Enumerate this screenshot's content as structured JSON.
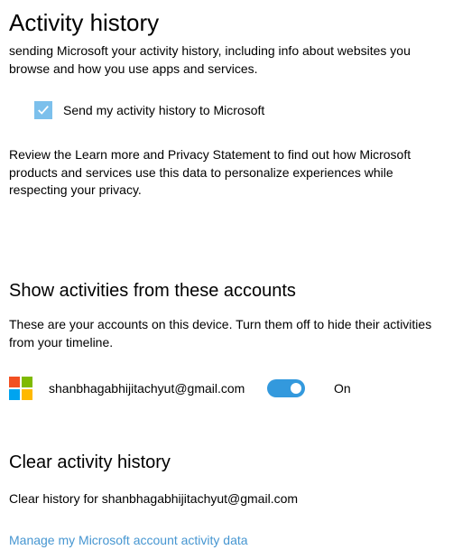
{
  "page": {
    "title": "Activity history",
    "description": "sending Microsoft your activity history, including info about websites you browse and how you use apps and services.",
    "send_checkbox": {
      "checked": true,
      "label": "Send my activity history to Microsoft"
    },
    "review_text": "Review the Learn more and Privacy Statement to find out how Microsoft products and services use this data to personalize experiences while respecting your privacy."
  },
  "accounts_section": {
    "heading": "Show activities from these accounts",
    "description": "These are your accounts on this device. Turn them off to hide their activities from your timeline.",
    "account": {
      "email": "shanbhagabhijitachyut@gmail.com",
      "toggle_state": "On"
    }
  },
  "clear_section": {
    "heading": "Clear activity history",
    "description": "Clear history for shanbhagabhijitachyut@gmail.com",
    "manage_link": "Manage my Microsoft account activity data"
  }
}
